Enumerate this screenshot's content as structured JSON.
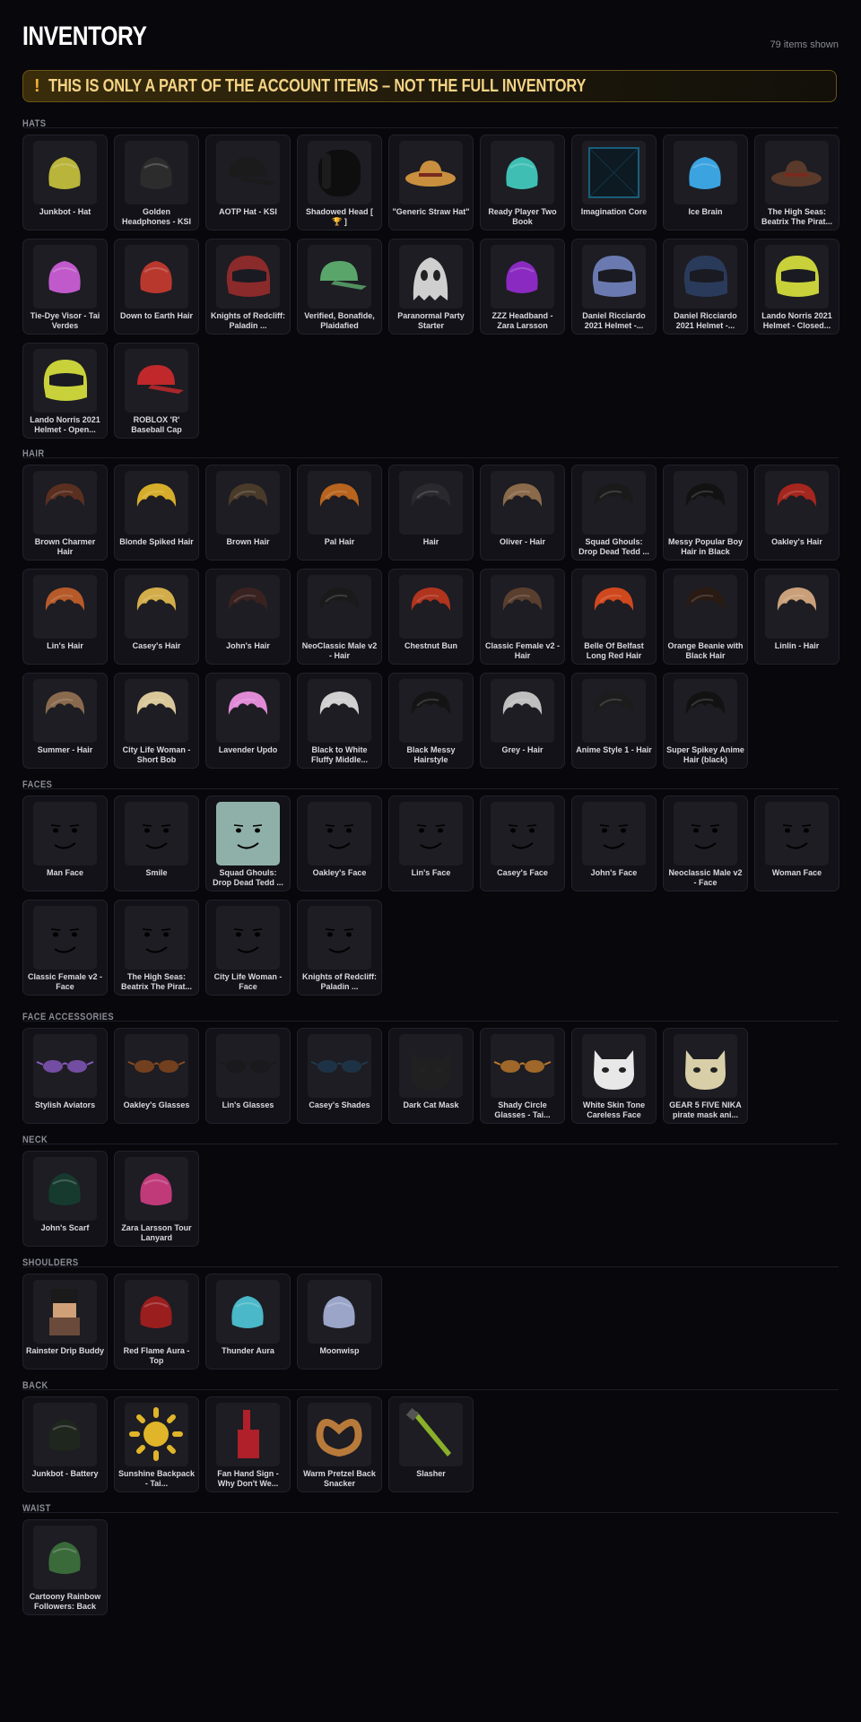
{
  "header": {
    "title": "INVENTORY",
    "count": "79 items shown"
  },
  "banner": {
    "icon": "!",
    "text": "THIS IS ONLY A PART OF THE ACCOUNT ITEMS – NOT THE FULL INVENTORY",
    "accent": "#f2b233"
  },
  "sections": [
    {
      "label": "HATS",
      "items": [
        {
          "name": "Junkbot - Hat",
          "icon": "junkbot-hat-icon",
          "color": "#b9b43a"
        },
        {
          "name": "Golden Headphones - KSI",
          "icon": "headphones-icon",
          "color": "#2c2c2c"
        },
        {
          "name": "AOTP Hat - KSI",
          "icon": "cap-icon",
          "color": "#1b1b1b"
        },
        {
          "name": "Shadowed Head [ 🏆 ]",
          "icon": "head-icon",
          "color": "#151515"
        },
        {
          "name": "\"Generic Straw Hat\"",
          "icon": "straw-hat-icon",
          "color": "#c98f3e"
        },
        {
          "name": "Ready Player Two Book",
          "icon": "book-icon",
          "color": "#3fbfb4"
        },
        {
          "name": "Imagination Core",
          "icon": "cube-icon",
          "color": "#1a5d7a"
        },
        {
          "name": "Ice Brain",
          "icon": "brain-icon",
          "color": "#3aa3e0"
        },
        {
          "name": "The High Seas: Beatrix The Pirat...",
          "icon": "pirate-hat-icon",
          "color": "#5a3a2a"
        },
        {
          "name": "Tie-Dye Visor - Tai Verdes",
          "icon": "visor-icon",
          "color": "#c05acb"
        },
        {
          "name": "Down to Earth Hair",
          "icon": "beanie-icon",
          "color": "#b9382e"
        },
        {
          "name": "Knights of Redcliff: Paladin ...",
          "icon": "helmet-icon",
          "color": "#8a2a2a"
        },
        {
          "name": "Verified, Bonafide, Plaidafied",
          "icon": "plaid-cap-icon",
          "color": "#5aa56a"
        },
        {
          "name": "Paranormal Party Starter",
          "icon": "ghost-icon",
          "color": "#cfcfcf"
        },
        {
          "name": "ZZZ Headband - Zara Larsson",
          "icon": "headband-icon",
          "color": "#8a2ac0"
        },
        {
          "name": "Daniel Ricciardo 2021 Helmet -...",
          "icon": "racing-helmet-icon",
          "color": "#6a7ab0"
        },
        {
          "name": "Daniel Ricciardo 2021 Helmet -...",
          "icon": "racing-helmet-icon",
          "color": "#2a3a5a"
        },
        {
          "name": "Lando Norris 2021 Helmet - Closed...",
          "icon": "racing-helmet-icon",
          "color": "#c8d13a"
        },
        {
          "name": "Lando Norris 2021 Helmet - Open...",
          "icon": "racing-helmet-icon",
          "color": "#c8d13a"
        },
        {
          "name": "ROBLOX 'R' Baseball Cap",
          "icon": "cap-icon",
          "color": "#c0282c"
        }
      ]
    },
    {
      "label": "HAIR",
      "items": [
        {
          "name": "Brown Charmer Hair",
          "icon": "hair-icon",
          "color": "#5a2f20"
        },
        {
          "name": "Blonde Spiked Hair",
          "icon": "hair-icon",
          "color": "#d6ad2a"
        },
        {
          "name": "Brown Hair",
          "icon": "hair-icon",
          "color": "#4a3a2a"
        },
        {
          "name": "Pal Hair",
          "icon": "hair-icon",
          "color": "#b8641e"
        },
        {
          "name": "Hair",
          "icon": "hair-icon",
          "color": "#2a2a2e"
        },
        {
          "name": "Oliver - Hair",
          "icon": "hair-icon",
          "color": "#8a6a4a"
        },
        {
          "name": "Squad Ghouls: Drop Dead Tedd ...",
          "icon": "hair-icon",
          "color": "#1a1a1a"
        },
        {
          "name": "Messy Popular Boy Hair in Black",
          "icon": "hair-icon",
          "color": "#121212"
        },
        {
          "name": "Oakley's Hair",
          "icon": "hair-icon",
          "color": "#a5261e"
        },
        {
          "name": "Lin's Hair",
          "icon": "hair-icon",
          "color": "#b65a2a"
        },
        {
          "name": "Casey's Hair",
          "icon": "hair-icon",
          "color": "#d3ad4a"
        },
        {
          "name": "John's Hair",
          "icon": "hair-icon",
          "color": "#3a2220"
        },
        {
          "name": "NeoClassic Male v2 - Hair",
          "icon": "hair-icon",
          "color": "#1a1a1a"
        },
        {
          "name": "Chestnut Bun",
          "icon": "hair-icon",
          "color": "#b0341e"
        },
        {
          "name": "Classic Female v2 - Hair",
          "icon": "hair-icon",
          "color": "#5a3e2e"
        },
        {
          "name": "Belle Of Belfast Long Red Hair",
          "icon": "hair-icon",
          "color": "#d0481e"
        },
        {
          "name": "Orange Beanie with Black Hair",
          "icon": "hair-icon",
          "color": "#2a1a14"
        },
        {
          "name": "Linlin - Hair",
          "icon": "hair-icon",
          "color": "#c9a07a"
        },
        {
          "name": "Summer - Hair",
          "icon": "hair-icon",
          "color": "#8a6a4e"
        },
        {
          "name": "City Life Woman - Short Bob",
          "icon": "hair-icon",
          "color": "#d9c79a"
        },
        {
          "name": "Lavender Updo",
          "icon": "hair-icon",
          "color": "#e08ad6"
        },
        {
          "name": "Black to White Fluffy Middle...",
          "icon": "hair-icon",
          "color": "#d0d0d0"
        },
        {
          "name": "Black Messy Hairstyle",
          "icon": "hair-icon",
          "color": "#141414"
        },
        {
          "name": "Grey - Hair",
          "icon": "hair-icon",
          "color": "#bfbfbf"
        },
        {
          "name": "Anime Style 1 - Hair",
          "icon": "hair-icon",
          "color": "#1c1c1c"
        },
        {
          "name": "Super Spikey Anime Hair (black)",
          "icon": "hair-icon",
          "color": "#121212"
        }
      ]
    },
    {
      "label": "FACES",
      "items": [
        {
          "name": "Man Face",
          "icon": "face-icon",
          "color": "#111"
        },
        {
          "name": "Smile",
          "icon": "face-icon",
          "color": "#111"
        },
        {
          "name": "Squad Ghouls: Drop Dead Tedd ...",
          "icon": "face-icon",
          "color": "#8fb0a8"
        },
        {
          "name": "Oakley's Face",
          "icon": "face-icon",
          "color": "#111"
        },
        {
          "name": "Lin's Face",
          "icon": "face-icon",
          "color": "#111"
        },
        {
          "name": "Casey's Face",
          "icon": "face-icon",
          "color": "#111"
        },
        {
          "name": "John's Face",
          "icon": "face-icon",
          "color": "#111"
        },
        {
          "name": "Neoclassic Male v2 - Face",
          "icon": "face-icon",
          "color": "#111"
        },
        {
          "name": "Woman Face",
          "icon": "face-icon",
          "color": "#111"
        },
        {
          "name": "Classic Female v2 - Face",
          "icon": "face-icon",
          "color": "#111"
        },
        {
          "name": "The High Seas: Beatrix The Pirat...",
          "icon": "face-icon",
          "color": "#111"
        },
        {
          "name": "City Life Woman - Face",
          "icon": "face-icon",
          "color": "#111"
        },
        {
          "name": "Knights of Redcliff: Paladin ...",
          "icon": "face-icon",
          "color": "#111"
        }
      ]
    },
    {
      "label": "FACE ACCESSORIES",
      "items": [
        {
          "name": "Stylish Aviators",
          "icon": "glasses-icon",
          "color": "#8a5ac0"
        },
        {
          "name": "Oakley's Glasses",
          "icon": "glasses-icon",
          "color": "#8a4a1e"
        },
        {
          "name": "Lin's Glasses",
          "icon": "glasses-icon",
          "color": "#1a1a1a"
        },
        {
          "name": "Casey's Shades",
          "icon": "glasses-icon",
          "color": "#1e3a4e"
        },
        {
          "name": "Dark Cat Mask",
          "icon": "mask-icon",
          "color": "#202020"
        },
        {
          "name": "Shady Circle Glasses - Tai...",
          "icon": "glasses-icon",
          "color": "#c07a2a"
        },
        {
          "name": "White Skin Tone Careless Face",
          "icon": "mask-icon",
          "color": "#e8e8e8"
        },
        {
          "name": "GEAR 5 FIVE NIKA pirate mask ani...",
          "icon": "mask-icon",
          "color": "#d8cfa8"
        }
      ]
    },
    {
      "label": "NECK",
      "items": [
        {
          "name": "John's Scarf",
          "icon": "scarf-icon",
          "color": "#173a2e"
        },
        {
          "name": "Zara Larsson Tour Lanyard",
          "icon": "lanyard-icon",
          "color": "#c03a7a"
        }
      ]
    },
    {
      "label": "SHOULDERS",
      "items": [
        {
          "name": "Rainster Drip Buddy",
          "icon": "buddy-icon",
          "color": "#6a4a3a"
        },
        {
          "name": "Red Flame Aura - Top",
          "icon": "aura-icon",
          "color": "#9a1e1e"
        },
        {
          "name": "Thunder Aura",
          "icon": "aura-icon",
          "color": "#4ab8c8"
        },
        {
          "name": "Moonwisp",
          "icon": "wisp-icon",
          "color": "#9aa5c8"
        }
      ]
    },
    {
      "label": "BACK",
      "items": [
        {
          "name": "Junkbot - Battery",
          "icon": "battery-icon",
          "color": "#1e261e"
        },
        {
          "name": "Sunshine Backpack - Tai...",
          "icon": "sun-icon",
          "color": "#e0b52a"
        },
        {
          "name": "Fan Hand Sign - Why Don't We...",
          "icon": "foam-hand-icon",
          "color": "#b0202a"
        },
        {
          "name": "Warm Pretzel Back Snacker",
          "icon": "pretzel-icon",
          "color": "#b87a3a"
        },
        {
          "name": "Slasher",
          "icon": "blade-icon",
          "color": "#8ab02a"
        }
      ]
    },
    {
      "label": "WAIST",
      "items": [
        {
          "name": "Cartoony Rainbow Followers: Back",
          "icon": "followers-icon",
          "color": "#3a6a3a"
        }
      ]
    }
  ]
}
